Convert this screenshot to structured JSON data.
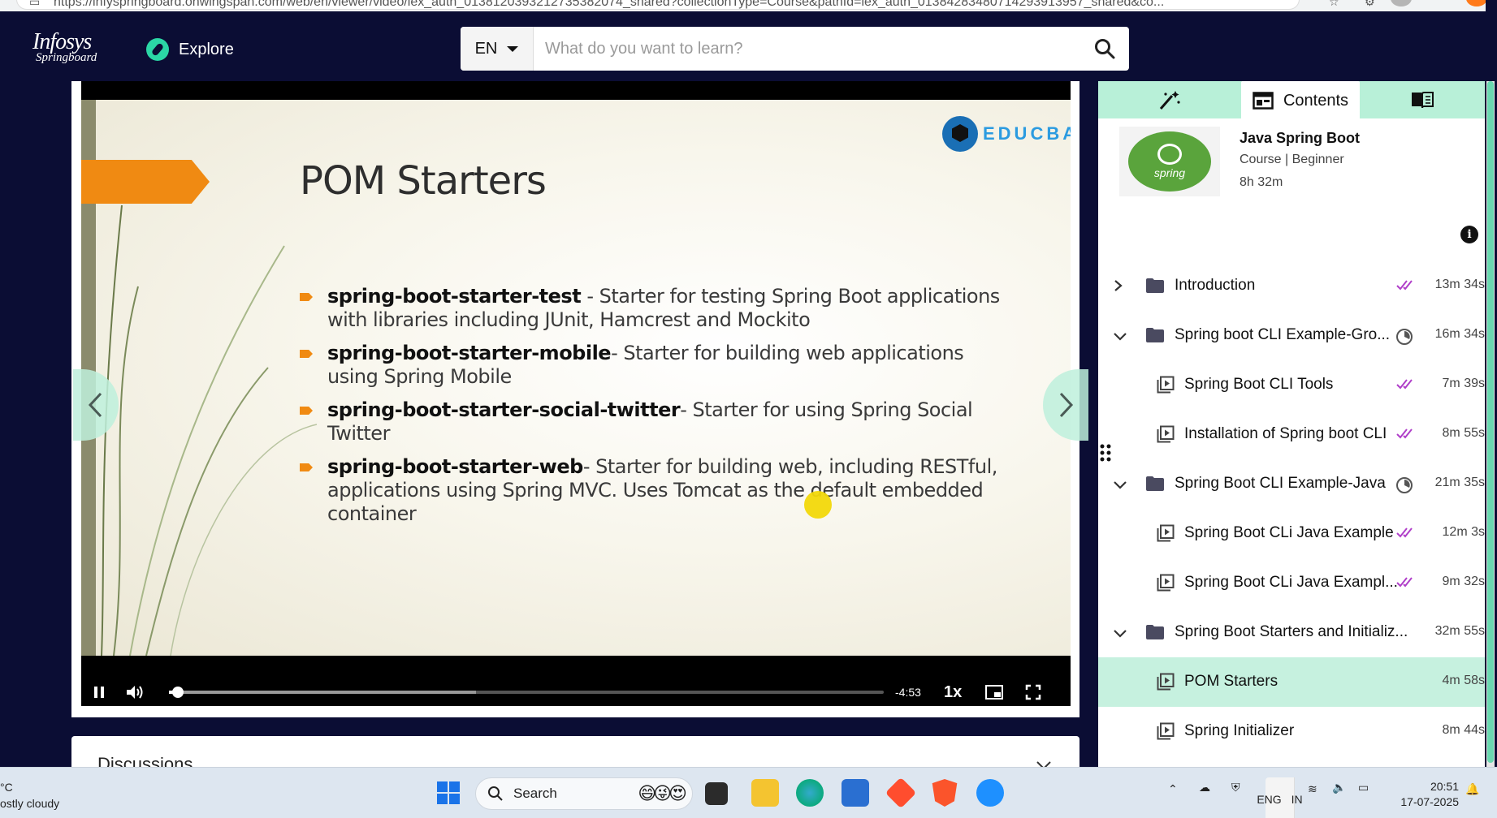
{
  "browser": {
    "url": "https://infyspringboard.onwingspan.com/web/en/viewer/video/lex_auth_0138120393212735382074_shared?collectionType=Course&pathId=lex_auth_01384283480714293913957_shared&co..."
  },
  "header": {
    "logo_line1": "Infosys",
    "logo_line2": "Springboard",
    "explore_label": "Explore",
    "language": "EN",
    "search_placeholder": "What do you want to learn?"
  },
  "slide": {
    "title": "POM Starters",
    "brand": "EDUCBA",
    "bullets": [
      {
        "name": "spring-boot-starter-test",
        "text": "     - Starter for testing Spring Boot applications with libraries including JUnit, Hamcrest and Mockito"
      },
      {
        "name": "spring-boot-starter-mobile",
        "text": "- Starter for building web applications using Spring Mobile"
      },
      {
        "name": "spring-boot-starter-social-twitter",
        "text": "-  Starter for using Spring Social Twitter"
      },
      {
        "name": "spring-boot-starter-web",
        "text": "- Starter for building web, including RESTful, applications using Spring MVC. Uses Tomcat as the default embedded container"
      }
    ]
  },
  "player": {
    "time_remaining": "-4:53",
    "speed": "1x",
    "progress_played": 0.013,
    "progress_buffered": 0.43
  },
  "discussions": {
    "title": "Discussions"
  },
  "sidebar": {
    "active_tab": "Contents",
    "course": {
      "title": "Java Spring Boot",
      "meta": "Course | Beginner",
      "duration": "8h 32m",
      "thumb_word": "spring"
    },
    "toc": [
      {
        "type": "section",
        "expanded": false,
        "label": "Introduction",
        "status": "done",
        "duration": "13m 34s"
      },
      {
        "type": "section",
        "expanded": true,
        "label": "Spring boot CLI Example-Gro...",
        "status": "partial",
        "duration": "16m 34s"
      },
      {
        "type": "item",
        "label": "Spring Boot CLI Tools",
        "status": "done",
        "duration": "7m 39s"
      },
      {
        "type": "item",
        "label": "Installation of Spring boot CLI",
        "status": "done",
        "duration": "8m 55s"
      },
      {
        "type": "section",
        "expanded": true,
        "label": "Spring Boot CLI Example-Java",
        "status": "partial",
        "duration": "21m 35s"
      },
      {
        "type": "item",
        "label": "Spring Boot CLi Java Example",
        "status": "done",
        "duration": "12m 3s"
      },
      {
        "type": "item",
        "label": "Spring Boot CLi Java Exampl...",
        "status": "done",
        "duration": "9m 32s"
      },
      {
        "type": "section",
        "expanded": true,
        "label": "Spring Boot Starters and Initializ...",
        "status": "none",
        "duration": "32m 55s"
      },
      {
        "type": "item",
        "label": "POM Starters",
        "status": "none",
        "duration": "4m 58s",
        "active": true
      },
      {
        "type": "item",
        "label": "Spring Initializer",
        "status": "none",
        "duration": "8m 44s"
      }
    ]
  },
  "taskbar": {
    "weather_temp": "°C",
    "weather_desc": "ostly cloudy",
    "search_label": "Search",
    "lang_line1": "ENG",
    "lang_line2": "IN",
    "time": "20:51",
    "date": "17-07-2025"
  },
  "colors": {
    "navy": "#0b0d34",
    "mint": "#b8f0d8",
    "active_row": "#c6f1df",
    "check_purple": "#b03fc9",
    "accent_orange": "#f08a12"
  }
}
